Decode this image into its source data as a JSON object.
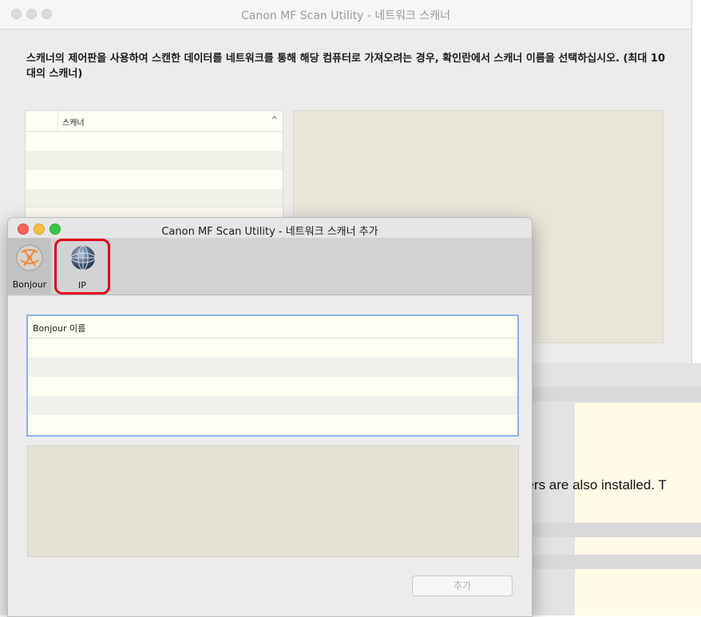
{
  "background_window": {
    "title": "Canon MF Scan Utility - 네트워크 스캐너",
    "description": "스캐너의 제어판을 사용하여 스캔한 데이터를 네트워크를 통해 해당 컴퓨터로 가져오려는 경우, 확인란에서 스캐너 이름을 선택하십시오. (최대 10대의 스캐너)",
    "list_header": "스캐너",
    "sort_indicator": "^"
  },
  "cutoff_text": "hers are also installed. T",
  "dialog": {
    "title": "Canon MF Scan Utility - 네트워크 스캐너 추가",
    "toolbar": {
      "bonjour_label": "Bonjour",
      "ip_label": "IP"
    },
    "list_header": "Bonjour 이름",
    "add_button": "추가"
  },
  "colors": {
    "highlight_red": "#e0001a",
    "list_focus_blue": "#8ab4e8"
  }
}
